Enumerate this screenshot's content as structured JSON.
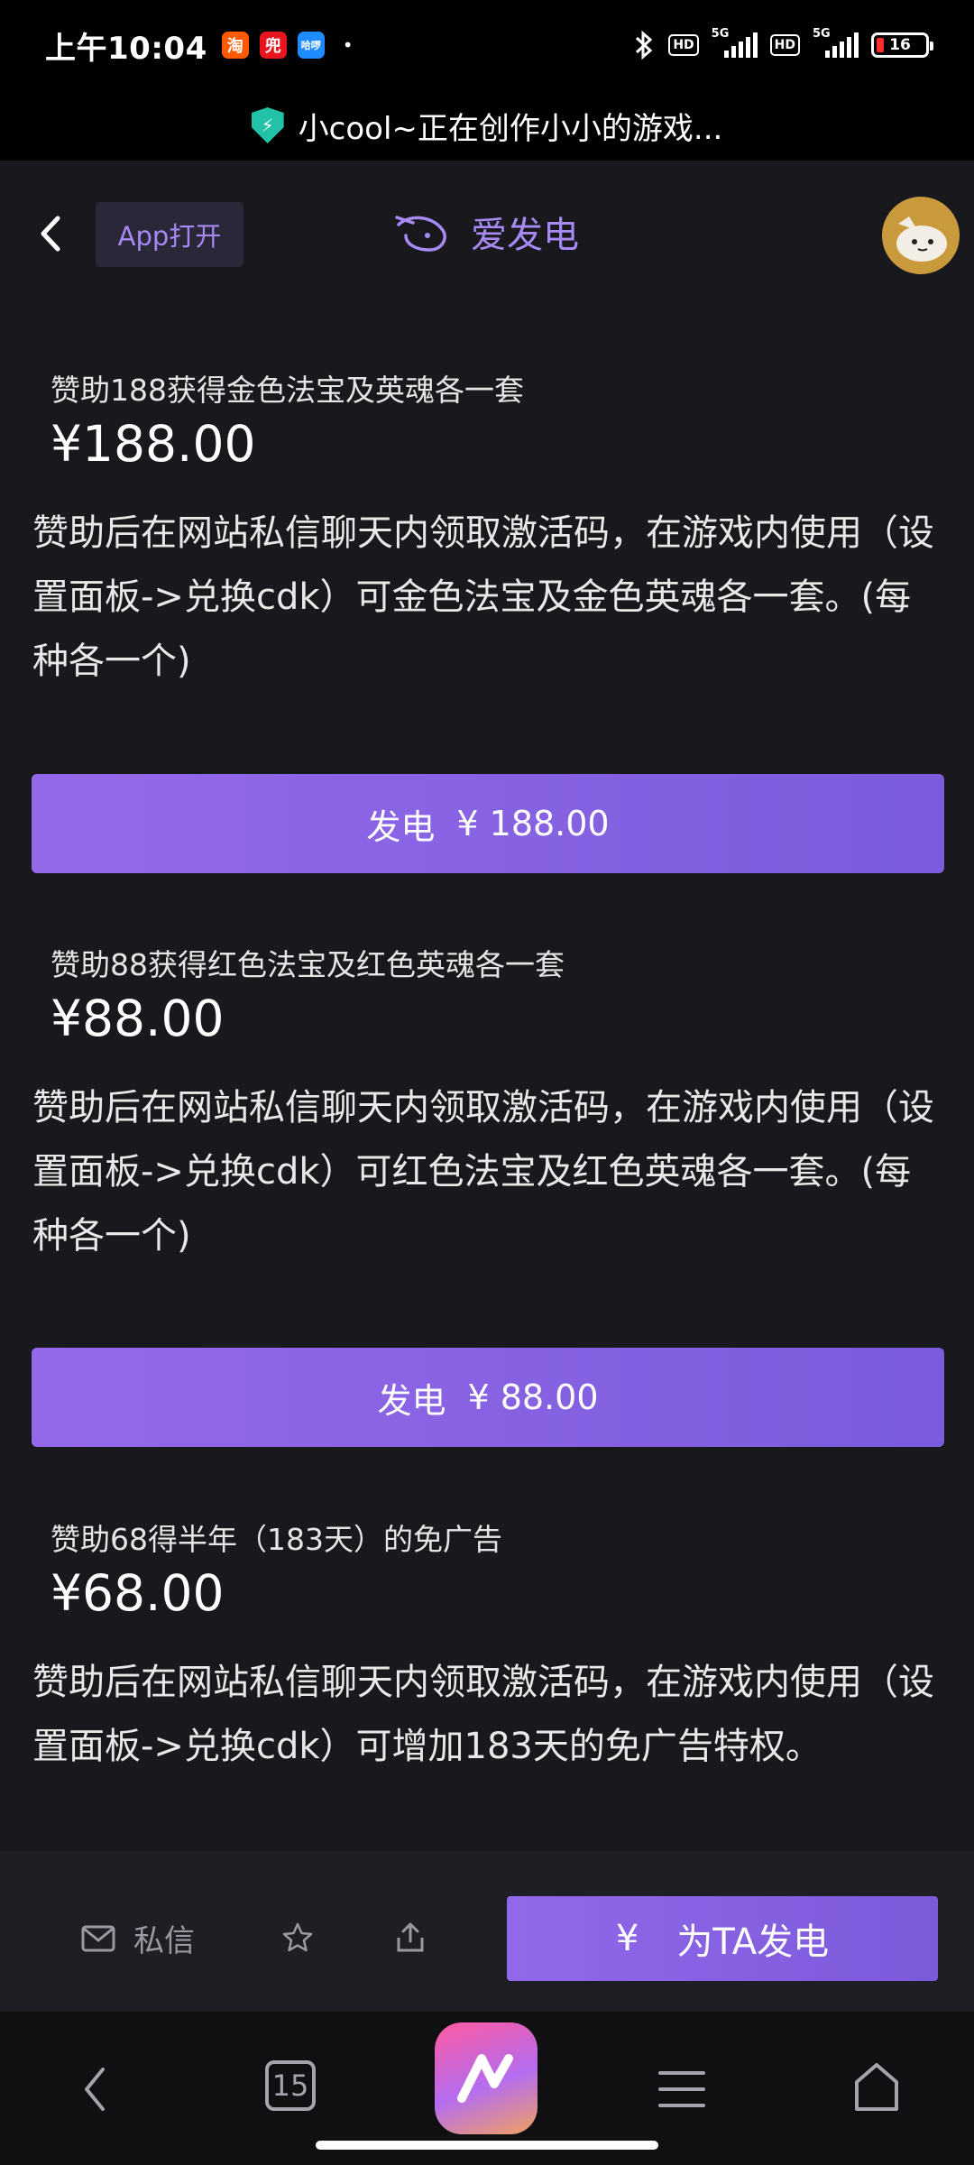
{
  "status_bar": {
    "time": "上午10:04",
    "apps": [
      "淘",
      "兜",
      "哈啰"
    ],
    "battery": "16",
    "network": "5G",
    "hd": "HD"
  },
  "browser": {
    "page_title": "小cool~正在创作小小的游戏..."
  },
  "header": {
    "app_open_label": "App打开",
    "brand_name": "爱发电"
  },
  "tiers": [
    {
      "title": "赞助188获得金色法宝及英魂各一套",
      "price": "¥188.00",
      "description": "赞助后在网站私信聊天内领取激活码，在游戏内使用（设置面板->兑换cdk）可金色法宝及金色英魂各一套。(每种各一个)",
      "button_label": "发电",
      "button_price": "¥ 188.00"
    },
    {
      "title": "赞助88获得红色法宝及红色英魂各一套",
      "price": "¥88.00",
      "description": "赞助后在网站私信聊天内领取激活码，在游戏内使用（设置面板->兑换cdk）可红色法宝及红色英魂各一套。(每种各一个)",
      "button_label": "发电",
      "button_price": "¥ 88.00"
    },
    {
      "title": "赞助68得半年（183天）的免广告",
      "price": "¥68.00",
      "description": "赞助后在网站私信聊天内领取激活码，在游戏内使用（设置面板->兑换cdk）可增加183天的免广告特权。"
    }
  ],
  "action_bar": {
    "message_label": "私信",
    "support_icon_text": "¥",
    "support_label": "为TA发电"
  },
  "nav_bar": {
    "tab_count": "15"
  },
  "colors": {
    "accent": "#8c65e6",
    "background": "#19181d",
    "brand_text": "#a88af5"
  }
}
